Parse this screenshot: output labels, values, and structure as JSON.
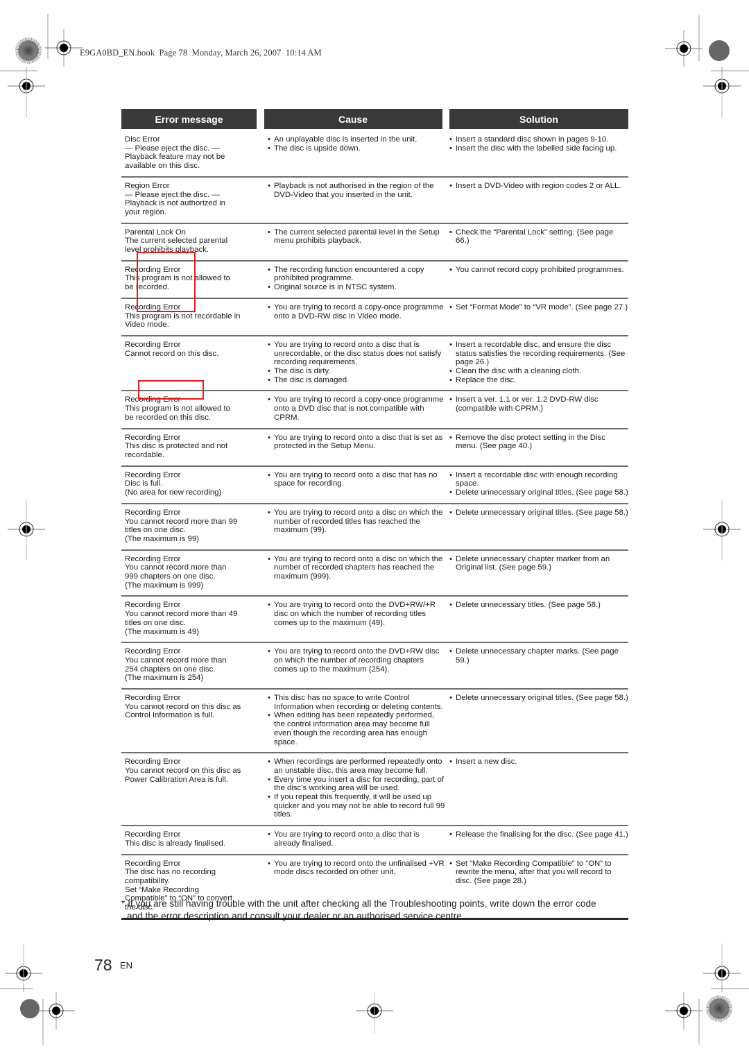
{
  "book_line": "E9GA0BD_EN.book  Page 78  Monday, March 26, 2007  10:14 AM",
  "table": {
    "headers": [
      "Error message",
      "Cause",
      "Solution"
    ],
    "rows": [
      {
        "error": [
          "Disc Error",
          "— Please eject the disc. —",
          "Playback feature may not be",
          "available on this disc."
        ],
        "cause": [
          "An unplayable disc is inserted in the unit.",
          "The disc is upside down."
        ],
        "solution": [
          "Insert a standard disc shown in pages 9-10.",
          "Insert the disc with the labelled side facing up."
        ]
      },
      {
        "error": [
          "Region Error",
          "— Please eject the disc. —",
          "Playback is not authorized in",
          "your region."
        ],
        "cause": [
          "Playback is not authorised in the region of the DVD-Video that you inserted in the unit."
        ],
        "solution": [
          "Insert a DVD-Video with region codes 2 or ALL."
        ]
      },
      {
        "error": [
          "Parental Lock On",
          "The current selected parental",
          "level prohibits playback."
        ],
        "cause": [
          "The current selected parental level in the Setup menu prohibits playback."
        ],
        "solution": [
          "Check the “Parental Lock” setting. (See page 66.)"
        ]
      },
      {
        "error": [
          "Recording Error",
          "This program is not allowed to",
          "be recorded."
        ],
        "cause": [
          "The recording function encountered a copy prohibited programme.",
          "Original source is in NTSC system."
        ],
        "solution": [
          "You cannot record copy prohibited programmes."
        ]
      },
      {
        "error": [
          "Recording Error",
          "This program is not recordable in",
          "Video mode."
        ],
        "cause": [
          "You are trying to record a copy-once programme onto a DVD-RW disc in Video mode."
        ],
        "solution": [
          "Set “Format Mode” to “VR mode”. (See page 27.)"
        ]
      },
      {
        "error": [
          "Recording Error",
          "Cannot record on this disc."
        ],
        "cause": [
          "You are trying to record onto a disc that is unrecordable, or the disc status does not satisfy recording requirements.",
          "The disc is dirty.",
          "The disc is damaged."
        ],
        "solution": [
          "Insert a recordable disc, and ensure the disc status satisfies the recording requirements. (See page 26.)",
          "Clean the disc with a cleaning cloth.",
          "Replace the disc."
        ]
      },
      {
        "error": [
          "Recording Error",
          "This program is not allowed to",
          "be recorded on this disc."
        ],
        "cause": [
          "You are trying to record a copy-once programme onto a DVD disc that is not compatible with CPRM."
        ],
        "solution": [
          "Insert a ver. 1.1 or ver. 1.2 DVD-RW disc (compatible with CPRM.)"
        ]
      },
      {
        "error": [
          "Recording Error",
          "This disc is protected and not",
          "recordable."
        ],
        "cause": [
          "You are trying to record onto a disc that is set as protected in the Setup Menu."
        ],
        "solution": [
          "Remove the disc protect setting in the Disc menu. (See page 40.)"
        ]
      },
      {
        "error": [
          "Recording Error",
          "Disc is full.",
          "(No area for new recording)"
        ],
        "cause": [
          "You are trying to record onto a disc that has no space for recording."
        ],
        "solution": [
          "Insert a recordable disc with enough recording space.",
          "Delete unnecessary original titles. (See page 58.)"
        ]
      },
      {
        "error": [
          "Recording Error",
          "You cannot record more than 99",
          "titles on one disc.",
          "(The maximum is 99)"
        ],
        "cause": [
          "You are trying to record onto a disc on which the number of recorded titles has reached the maximum (99)."
        ],
        "solution": [
          "Delete unnecessary original titles. (See page 58.)"
        ]
      },
      {
        "error": [
          "Recording Error",
          "You cannot record more than",
          "999 chapters on one disc.",
          "(The maximum is 999)"
        ],
        "cause": [
          "You are trying to record onto a disc on which the number of recorded chapters has reached the maximum (999)."
        ],
        "solution": [
          "Delete unnecessary chapter marker from an Original list. (See page 59.)"
        ]
      },
      {
        "error": [
          "Recording Error",
          "You cannot record more than 49",
          "titles on one disc.",
          "(The maximum is 49)"
        ],
        "cause": [
          "You are trying to record onto the DVD+RW/+R disc on which the number of recording titles comes up to the maximum (49)."
        ],
        "solution": [
          "Delete unnecessary titles. (See page 58.)"
        ]
      },
      {
        "error": [
          "Recording Error",
          "You cannot record more than",
          "254 chapters on one disc.",
          "(The maximum is 254)"
        ],
        "cause": [
          "You are trying to record onto the DVD+RW disc on which the number of recording chapters comes up to the maximum (254)."
        ],
        "solution": [
          "Delete unnecessary chapter marks. (See page 59.)"
        ]
      },
      {
        "error": [
          "Recording Error",
          "You cannot record on this disc as",
          "Control Information is full."
        ],
        "cause": [
          "This disc has no space to write Control Information when recording or deleting contents.",
          "When editing has been repeatedly performed, the control information area may become full even though the recording area has enough space."
        ],
        "solution": [
          "Delete unnecessary original titles. (See page 58.)"
        ]
      },
      {
        "error": [
          "Recording Error",
          "You cannot record on this disc as",
          "Power Calibration Area is full."
        ],
        "cause": [
          "When recordings are performed repeatedly onto an unstable disc, this area may become full.",
          "Every time you insert a disc for recording, part of the disc’s working area will be used.",
          "If you repeat this frequently, it will be used up quicker and you may not be able to record full 99 titles."
        ],
        "solution": [
          "Insert a new disc."
        ]
      },
      {
        "error": [
          "Recording Error",
          "This disc is already finalised."
        ],
        "cause": [
          "You are trying to record onto a disc that is already finalised."
        ],
        "solution": [
          "Release the finalising for the disc. (See page 41.)"
        ]
      },
      {
        "error": [
          "Recording Error",
          "The disc has no recording",
          "compatibility.",
          "Set “Make Recording",
          "Compatible” to “ON” to convert",
          "the disc."
        ],
        "cause": [
          "You are trying to record onto the unfinalised +VR mode discs recorded on other unit."
        ],
        "solution": [
          "Set “Make Recording Compatible” to “ON” to rewrite the menu, after that you will record to disc. (See page 28.)"
        ]
      }
    ]
  },
  "footnote": {
    "line1": "* If you are still having trouble with the unit after checking all the Troubleshooting points, write down the error code",
    "line2": "and the error description and consult your dealer or an authorised service centre."
  },
  "page": {
    "number": "78",
    "lang": "EN"
  },
  "bullet_glyph": "•",
  "colors": {
    "header_bg": "#3a3a3a",
    "header_text": "#ffffff",
    "highlight": "#e11a1a"
  }
}
